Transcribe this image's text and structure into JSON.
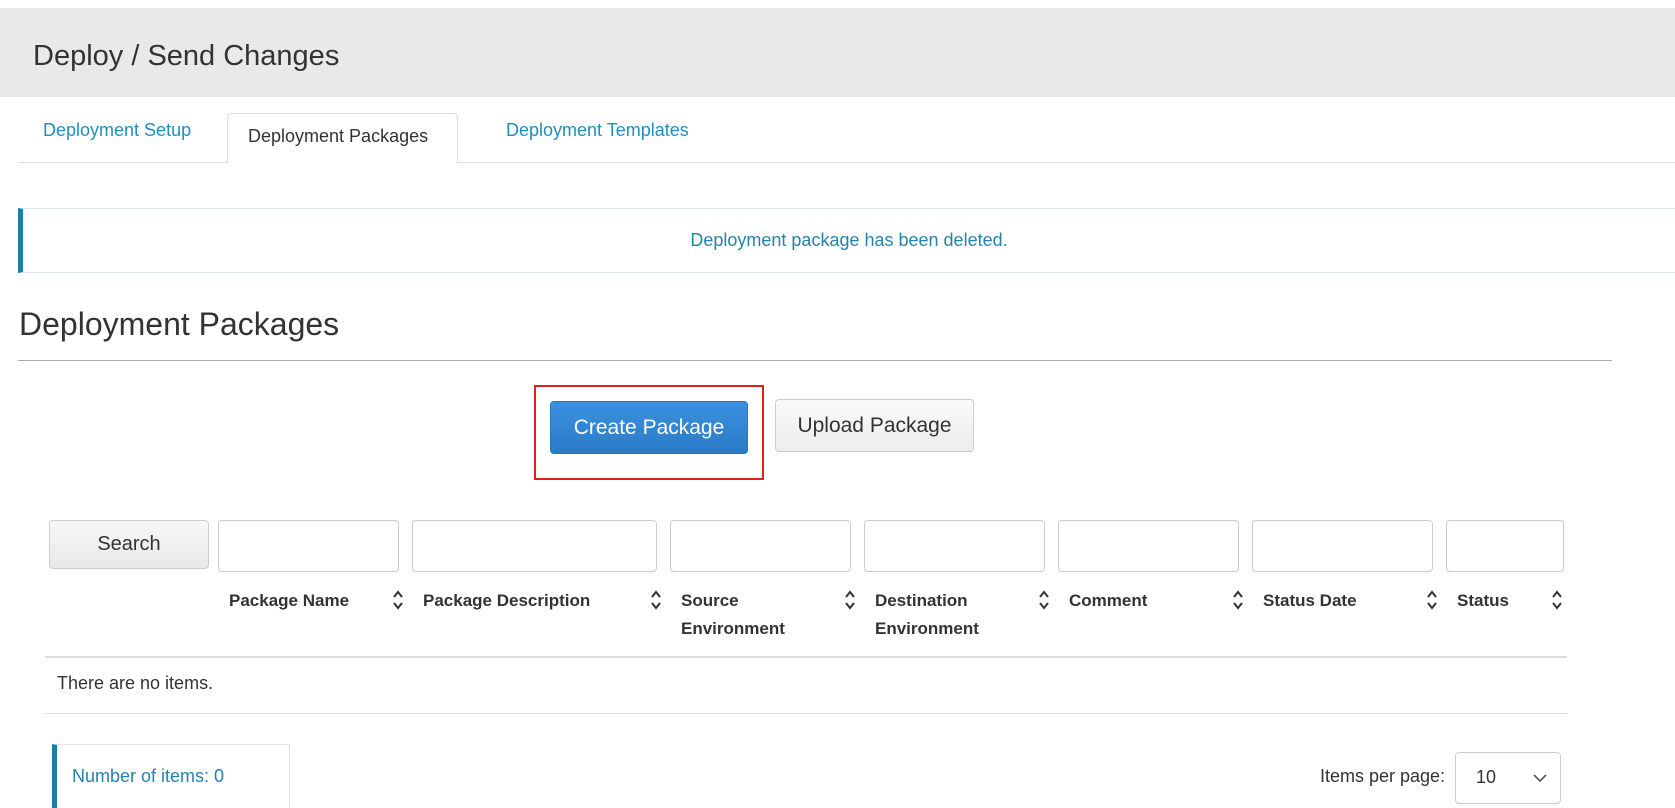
{
  "header": {
    "title": "Deploy / Send Changes"
  },
  "tabs": [
    {
      "label": "Deployment Setup",
      "active": false
    },
    {
      "label": "Deployment Packages",
      "active": true
    },
    {
      "label": "Deployment Templates",
      "active": false
    }
  ],
  "alert": {
    "message": "Deployment package has been deleted."
  },
  "section": {
    "title": "Deployment Packages"
  },
  "actions": {
    "create_label": "Create Package",
    "upload_label": "Upload Package"
  },
  "table": {
    "search_label": "Search",
    "columns": [
      {
        "line1": "Package Name",
        "line2": ""
      },
      {
        "line1": "Package Description",
        "line2": ""
      },
      {
        "line1": "Source",
        "line2": "Environment"
      },
      {
        "line1": "Destination",
        "line2": "Environment"
      },
      {
        "line1": "Comment",
        "line2": ""
      },
      {
        "line1": "Status Date",
        "line2": ""
      },
      {
        "line1": "Status",
        "line2": ""
      }
    ],
    "filters": [
      "",
      "",
      "",
      "",
      "",
      "",
      ""
    ],
    "empty_message": "There are no items."
  },
  "footer": {
    "count_label": "Number of items: 0",
    "items_per_page_label": "Items per page:",
    "items_per_page_value": "10"
  },
  "colors": {
    "accent": "#1a7fa3",
    "link": "#1f8fbd",
    "primary_button": "#2f84d3",
    "highlight": "#e02020"
  }
}
